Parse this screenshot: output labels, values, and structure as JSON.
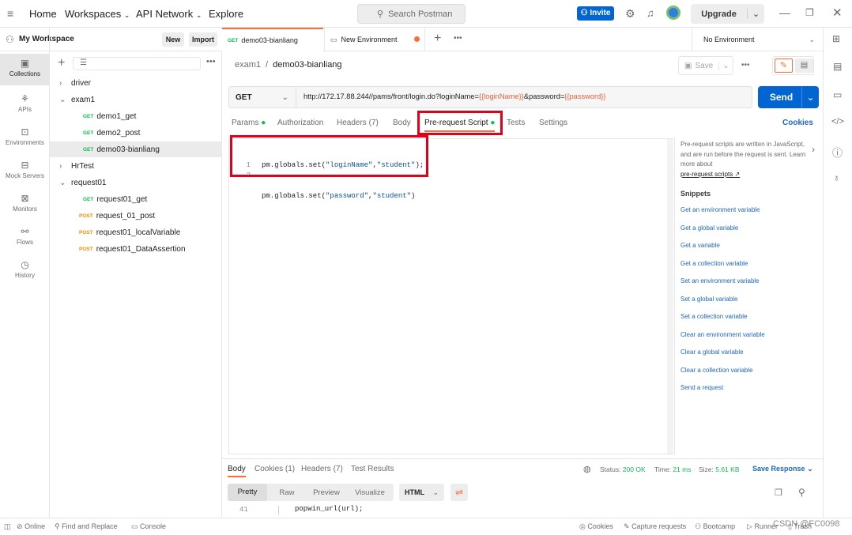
{
  "topbar": {
    "nav": [
      "Home",
      "Workspaces",
      "API Network",
      "Explore"
    ],
    "search_placeholder": "Search Postman",
    "invite_label": "Invite",
    "upgrade_label": "Upgrade"
  },
  "workspace": {
    "name": "My Workspace",
    "new_label": "New",
    "import_label": "Import"
  },
  "rail": [
    "Collections",
    "APIs",
    "Environments",
    "Mock Servers",
    "Monitors",
    "Flows",
    "History"
  ],
  "tree": [
    {
      "label": "driver",
      "type": "folder",
      "expanded": false
    },
    {
      "label": "exam1",
      "type": "folder",
      "expanded": true
    },
    {
      "label": "demo1_get",
      "method": "GET"
    },
    {
      "label": "demo2_post",
      "method": "GET"
    },
    {
      "label": "demo03-bianliang",
      "method": "GET",
      "selected": true
    },
    {
      "label": "HrTest",
      "type": "folder",
      "expanded": false
    },
    {
      "label": "request01",
      "type": "folder",
      "expanded": true
    },
    {
      "label": "request01_get",
      "method": "GET"
    },
    {
      "label": "request_01_post",
      "method": "POST"
    },
    {
      "label": "request01_localVariable",
      "method": "POST"
    },
    {
      "label": "request01_DataAssertion",
      "method": "POST"
    }
  ],
  "tabs": {
    "tab1_method": "GET",
    "tab1_label": "demo03-bianliang",
    "tab2_label": "New Environment",
    "environment": "No Environment"
  },
  "breadcrumb": {
    "parent": "exam1",
    "sep": "/",
    "current": "demo03-bianliang",
    "save_label": "Save"
  },
  "request": {
    "method": "GET",
    "url_prefix": "http://172.17.88.244//pams/front/login.do?loginName=",
    "var1": "{{loginName}}",
    "url_mid": "&password=",
    "var2": "{{password}}",
    "send_label": "Send"
  },
  "req_tabs": [
    "Params",
    "Authorization",
    "Headers (7)",
    "Body",
    "Pre-request Script",
    "Tests",
    "Settings"
  ],
  "cookies_label": "Cookies",
  "script": {
    "line_numbers": [
      "1",
      "2"
    ],
    "line1_a": "pm.globals.set(",
    "line1_s1": "\"loginName\"",
    "line1_c": ",",
    "line1_s2": "\"student\"",
    "line1_end": ");",
    "line2_a": "pm.globals.set(",
    "line2_s1": "\"password\"",
    "line2_c": ",",
    "line2_s2": "\"student\"",
    "line2_end": ")"
  },
  "snippets": {
    "intro": "Pre-request scripts are written in JavaScript, and are run before the request is sent. Learn more about",
    "link": "pre-request scripts ↗",
    "heading": "Snippets",
    "items": [
      "Get an environment variable",
      "Get a global variable",
      "Get a variable",
      "Get a collection variable",
      "Set an environment variable",
      "Set a global variable",
      "Set a collection variable",
      "Clear an environment variable",
      "Clear a global variable",
      "Clear a collection variable",
      "Send a request"
    ]
  },
  "response": {
    "tabs": [
      "Body",
      "Cookies (1)",
      "Headers (7)",
      "Test Results"
    ],
    "status_label": "Status:",
    "status_value": "200 OK",
    "time_label": "Time:",
    "time_value": "21 ms",
    "size_label": "Size:",
    "size_value": "5.61 KB",
    "save_response": "Save Response",
    "views": [
      "Pretty",
      "Raw",
      "Preview",
      "Visualize"
    ],
    "format": "HTML",
    "line_no": "41",
    "line_text": "popwin_url(url);"
  },
  "statusbar": {
    "online": "Online",
    "find": "Find and Replace",
    "console": "Console",
    "cookies": "Cookies",
    "capture": "Capture requests",
    "bootcamp": "Bootcamp",
    "runner": "Runner",
    "trash": "Trash",
    "watermark": "CSDN @FC0098"
  },
  "colors": {
    "accent": "#0265d2",
    "get": "#0cbb52",
    "post": "#ff8c00",
    "highlight_box": "#e0001b",
    "variable": "#e8633b"
  }
}
